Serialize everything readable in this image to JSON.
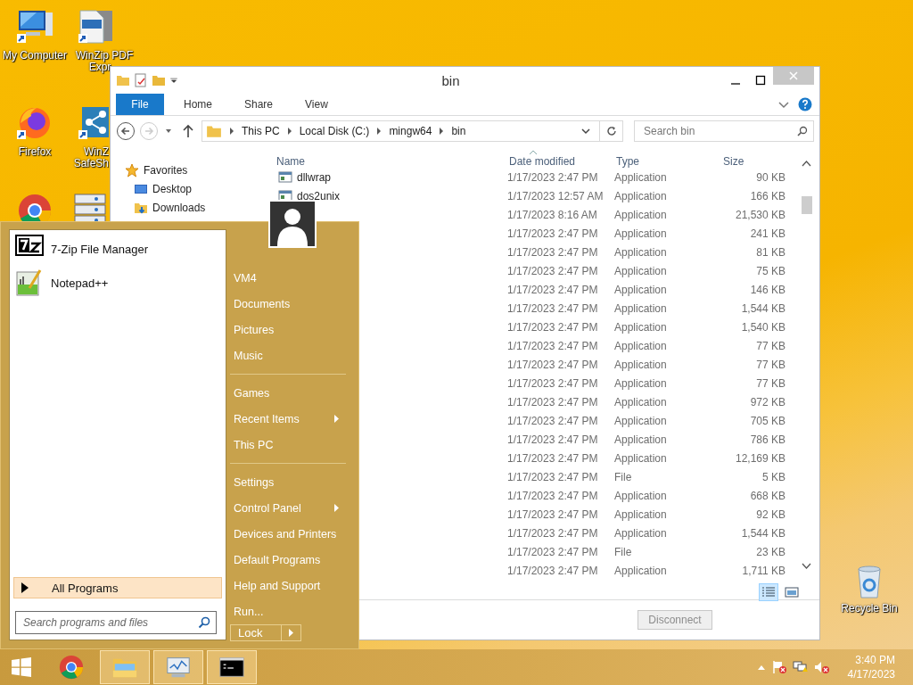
{
  "desktop_icons": [
    {
      "kind": "computer",
      "lines": [
        "My Computer"
      ]
    },
    {
      "kind": "pdf",
      "lines": [
        "WinZip PDF",
        "Expr"
      ]
    },
    {
      "kind": "firefox",
      "lines": [
        "Firefox"
      ]
    },
    {
      "kind": "share",
      "lines": [
        "WinZ",
        "SafeSh"
      ]
    },
    {
      "kind": "chrome"
    },
    {
      "kind": "server"
    },
    {
      "kind": "recycle",
      "lines": [
        "Recycle Bin"
      ]
    }
  ],
  "explorer": {
    "title": "bin",
    "file_tab": "File",
    "tabs": [
      "Home",
      "Share",
      "View"
    ],
    "path": [
      "This PC",
      "Local Disk (C:)",
      "mingw64",
      "bin"
    ],
    "search": {
      "placeholder": "Search bin"
    },
    "nav": [
      {
        "kind": "star",
        "label": "Favorites"
      },
      {
        "kind": "desktop",
        "label": "Desktop"
      },
      {
        "kind": "downloads",
        "label": "Downloads"
      }
    ],
    "columns": [
      "Name",
      "Date modified",
      "Type",
      "Size"
    ],
    "rows": [
      {
        "name": "dllwrap",
        "date": "1/17/2023 2:47 PM",
        "type": "Application",
        "size": "90 KB"
      },
      {
        "name": "dos2unix",
        "date": "1/17/2023 12:57 AM",
        "type": "Application",
        "size": "166 KB"
      },
      {
        "date": "1/17/2023 8:16 AM",
        "type": "Application",
        "size": "21,530 KB"
      },
      {
        "date": "1/17/2023 2:47 PM",
        "type": "Application",
        "size": "241 KB"
      },
      {
        "date": "1/17/2023 2:47 PM",
        "type": "Application",
        "size": "81 KB"
      },
      {
        "date": "1/17/2023 2:47 PM",
        "type": "Application",
        "size": "75 KB"
      },
      {
        "date": "1/17/2023 2:47 PM",
        "type": "Application",
        "size": "146 KB"
      },
      {
        "date": "1/17/2023 2:47 PM",
        "type": "Application",
        "size": "1,544 KB"
      },
      {
        "date": "1/17/2023 2:47 PM",
        "type": "Application",
        "size": "1,540 KB"
      },
      {
        "date": "1/17/2023 2:47 PM",
        "type": "Application",
        "size": "77 KB"
      },
      {
        "date": "1/17/2023 2:47 PM",
        "type": "Application",
        "size": "77 KB"
      },
      {
        "date": "1/17/2023 2:47 PM",
        "type": "Application",
        "size": "77 KB"
      },
      {
        "date": "1/17/2023 2:47 PM",
        "type": "Application",
        "size": "972 KB"
      },
      {
        "date": "1/17/2023 2:47 PM",
        "type": "Application",
        "size": "705 KB"
      },
      {
        "date": "1/17/2023 2:47 PM",
        "type": "Application",
        "size": "786 KB"
      },
      {
        "date": "1/17/2023 2:47 PM",
        "type": "Application",
        "size": "12,169 KB"
      },
      {
        "date": "1/17/2023 2:47 PM",
        "type": "File",
        "size": "5 KB"
      },
      {
        "date": "1/17/2023 2:47 PM",
        "type": "Application",
        "size": "668 KB"
      },
      {
        "date": "1/17/2023 2:47 PM",
        "type": "Application",
        "size": "92 KB"
      },
      {
        "date": "1/17/2023 2:47 PM",
        "type": "Application",
        "size": "1,544 KB"
      },
      {
        "date": "1/17/2023 2:47 PM",
        "type": "File",
        "size": "23 KB"
      },
      {
        "date": "1/17/2023 2:47 PM",
        "type": "Application",
        "size": "1,711 KB"
      }
    ],
    "disconnect": {
      "label": "Disconnect",
      "disabled": true
    }
  },
  "start_menu": {
    "pinned": [
      {
        "kind": "sevenzip",
        "label": "7-Zip File Manager"
      },
      {
        "kind": "notepad",
        "label": "Notepad++"
      }
    ],
    "all_programs": "All Programs",
    "search": {
      "placeholder": "Search programs and files"
    },
    "link_groups": [
      {
        "links": [
          {
            "label": "VM4",
            "submenu": false
          },
          {
            "label": "Documents",
            "submenu": false
          },
          {
            "label": "Pictures",
            "submenu": false
          },
          {
            "label": "Music",
            "submenu": false
          }
        ]
      },
      {
        "links": [
          {
            "label": "Games",
            "submenu": false
          },
          {
            "label": "Recent Items",
            "submenu": true
          },
          {
            "label": "This PC",
            "submenu": false
          }
        ]
      },
      {
        "links": [
          {
            "label": "Settings",
            "submenu": false
          },
          {
            "label": "Control Panel",
            "submenu": true
          },
          {
            "label": "Devices and Printers",
            "submenu": false
          },
          {
            "label": "Default Programs",
            "submenu": false
          },
          {
            "label": "Help and Support",
            "submenu": false
          },
          {
            "label": "Run...",
            "submenu": false
          }
        ]
      }
    ],
    "power": "Lock"
  },
  "taskbar": {
    "items": [
      {
        "kind": "chrome",
        "active": false
      },
      {
        "kind": "explorer",
        "active": true
      },
      {
        "kind": "monitor",
        "active": true
      },
      {
        "kind": "cmd",
        "active": true
      }
    ],
    "time": "3:40 PM",
    "date": "4/17/2023"
  }
}
